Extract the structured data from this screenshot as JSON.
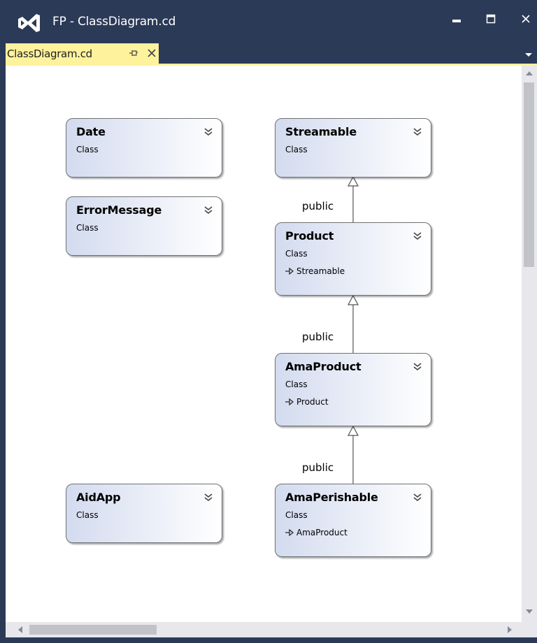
{
  "window": {
    "title": "FP - ClassDiagram.cd",
    "logo_icon": "visual-studio-logo-icon"
  },
  "tab": {
    "label": "ClassDiagram.cd",
    "pin_icon": "pin-icon",
    "close_icon": "close-icon"
  },
  "classes": [
    {
      "name": "Date",
      "kind": "Class",
      "base": ""
    },
    {
      "name": "ErrorMessage",
      "kind": "Class",
      "base": ""
    },
    {
      "name": "AidApp",
      "kind": "Class",
      "base": ""
    },
    {
      "name": "Streamable",
      "kind": "Class",
      "base": ""
    },
    {
      "name": "Product",
      "kind": "Class",
      "base": "Streamable"
    },
    {
      "name": "AmaProduct",
      "kind": "Class",
      "base": "Product"
    },
    {
      "name": "AmaPerishable",
      "kind": "Class",
      "base": "AmaProduct"
    }
  ],
  "connectors": [
    {
      "label": "public",
      "from": "Product",
      "to": "Streamable"
    },
    {
      "label": "public",
      "from": "AmaProduct",
      "to": "Product"
    },
    {
      "label": "public",
      "from": "AmaPerishable",
      "to": "AmaProduct"
    }
  ],
  "colors": {
    "frame": "#2b3a57",
    "tab_active": "#fff29d",
    "shape_gradient_left": "#d3dbef",
    "shape_gradient_right": "#ffffff"
  }
}
